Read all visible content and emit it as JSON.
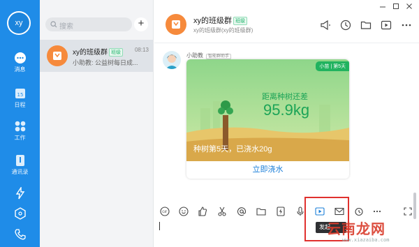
{
  "user": {
    "avatar_text": "xy"
  },
  "nav": {
    "items": [
      {
        "key": "messages",
        "label": "消息",
        "icon": "chat-bubble-icon",
        "active": true
      },
      {
        "key": "calendar",
        "label": "日程",
        "icon": "calendar-icon",
        "badge": "15"
      },
      {
        "key": "work",
        "label": "工作",
        "icon": "apps-grid-icon"
      },
      {
        "key": "contacts",
        "label": "通讯录",
        "icon": "contacts-icon"
      },
      {
        "key": "lightning",
        "label": "",
        "icon": "lightning-icon"
      },
      {
        "key": "cube",
        "label": "",
        "icon": "cube-icon"
      },
      {
        "key": "phone",
        "label": "",
        "icon": "phone-icon"
      }
    ]
  },
  "search": {
    "placeholder": "搜索"
  },
  "add_button": {
    "label": "+"
  },
  "conversations": [
    {
      "name": "xy的班级群",
      "tag": "班级",
      "time": "08:13",
      "preview": "小助教: 公益树每日成..."
    }
  ],
  "chat_header": {
    "title": "xy的班级群",
    "tag": "班级",
    "subtitle": "xy的班级群(xy的班级群)",
    "icons": [
      "megaphone-icon",
      "clock-icon",
      "folder-icon",
      "play-video-icon",
      "more-icon"
    ]
  },
  "message": {
    "sender": "小助教",
    "sender_tag": "智能群助手",
    "card": {
      "badge": "小苗 | 第5天",
      "distance_label": "距离种树还差",
      "distance_value": "95.9kg",
      "status": "种树第5天，已浇水20g",
      "action": "立即浇水"
    }
  },
  "toolbar": {
    "icons": [
      "gif-icon",
      "emoji-icon",
      "thumbs-up-icon",
      "scissors-icon",
      "at-icon",
      "folder-icon",
      "lightning-doc-icon",
      "microphone-icon",
      "video-play-icon",
      "mail-icon",
      "alarm-icon",
      "more-icon",
      "expand-icon"
    ]
  },
  "tooltip": {
    "text": "发起"
  },
  "watermark": {
    "brand": "云南龙网",
    "url": "www.xiazaiba.com"
  },
  "colors": {
    "nav_bg": "#1f8ce8",
    "accent_green": "#21b35f",
    "link_blue": "#1b7fd9",
    "highlight_red": "#e0312e"
  }
}
